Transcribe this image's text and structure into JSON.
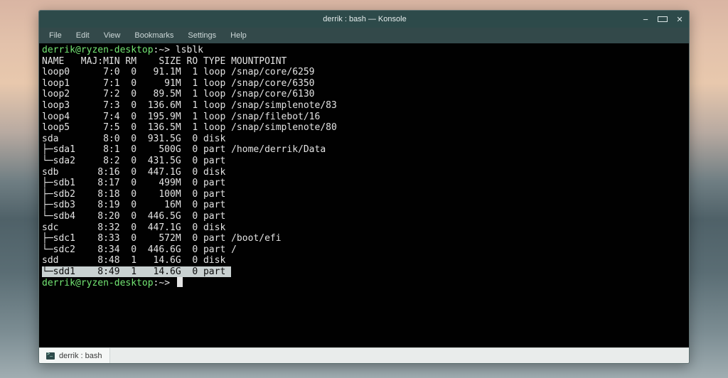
{
  "titlebar": {
    "title": "derrik : bash — Konsole"
  },
  "menubar": {
    "items": [
      "File",
      "Edit",
      "View",
      "Bookmarks",
      "Settings",
      "Help"
    ]
  },
  "prompt": {
    "user_host": "derrik@ryzen-desktop",
    "path_sep": ":~> ",
    "command": "lsblk"
  },
  "lsblk": {
    "header": [
      "NAME",
      "MAJ:MIN",
      "RM",
      "SIZE",
      "RO",
      "TYPE",
      "MOUNTPOINT"
    ],
    "rows": [
      {
        "tree": "",
        "name": "loop0",
        "maj": "7:0",
        "rm": "0",
        "size": "91.1M",
        "ro": "1",
        "type": "loop",
        "mnt": "/snap/core/6259"
      },
      {
        "tree": "",
        "name": "loop1",
        "maj": "7:1",
        "rm": "0",
        "size": "91M",
        "ro": "1",
        "type": "loop",
        "mnt": "/snap/core/6350"
      },
      {
        "tree": "",
        "name": "loop2",
        "maj": "7:2",
        "rm": "0",
        "size": "89.5M",
        "ro": "1",
        "type": "loop",
        "mnt": "/snap/core/6130"
      },
      {
        "tree": "",
        "name": "loop3",
        "maj": "7:3",
        "rm": "0",
        "size": "136.6M",
        "ro": "1",
        "type": "loop",
        "mnt": "/snap/simplenote/83"
      },
      {
        "tree": "",
        "name": "loop4",
        "maj": "7:4",
        "rm": "0",
        "size": "195.9M",
        "ro": "1",
        "type": "loop",
        "mnt": "/snap/filebot/16"
      },
      {
        "tree": "",
        "name": "loop5",
        "maj": "7:5",
        "rm": "0",
        "size": "136.5M",
        "ro": "1",
        "type": "loop",
        "mnt": "/snap/simplenote/80"
      },
      {
        "tree": "",
        "name": "sda",
        "maj": "8:0",
        "rm": "0",
        "size": "931.5G",
        "ro": "0",
        "type": "disk",
        "mnt": ""
      },
      {
        "tree": "├─",
        "name": "sda1",
        "maj": "8:1",
        "rm": "0",
        "size": "500G",
        "ro": "0",
        "type": "part",
        "mnt": "/home/derrik/Data"
      },
      {
        "tree": "└─",
        "name": "sda2",
        "maj": "8:2",
        "rm": "0",
        "size": "431.5G",
        "ro": "0",
        "type": "part",
        "mnt": ""
      },
      {
        "tree": "",
        "name": "sdb",
        "maj": "8:16",
        "rm": "0",
        "size": "447.1G",
        "ro": "0",
        "type": "disk",
        "mnt": ""
      },
      {
        "tree": "├─",
        "name": "sdb1",
        "maj": "8:17",
        "rm": "0",
        "size": "499M",
        "ro": "0",
        "type": "part",
        "mnt": ""
      },
      {
        "tree": "├─",
        "name": "sdb2",
        "maj": "8:18",
        "rm": "0",
        "size": "100M",
        "ro": "0",
        "type": "part",
        "mnt": ""
      },
      {
        "tree": "├─",
        "name": "sdb3",
        "maj": "8:19",
        "rm": "0",
        "size": "16M",
        "ro": "0",
        "type": "part",
        "mnt": ""
      },
      {
        "tree": "└─",
        "name": "sdb4",
        "maj": "8:20",
        "rm": "0",
        "size": "446.5G",
        "ro": "0",
        "type": "part",
        "mnt": ""
      },
      {
        "tree": "",
        "name": "sdc",
        "maj": "8:32",
        "rm": "0",
        "size": "447.1G",
        "ro": "0",
        "type": "disk",
        "mnt": ""
      },
      {
        "tree": "├─",
        "name": "sdc1",
        "maj": "8:33",
        "rm": "0",
        "size": "572M",
        "ro": "0",
        "type": "part",
        "mnt": "/boot/efi"
      },
      {
        "tree": "└─",
        "name": "sdc2",
        "maj": "8:34",
        "rm": "0",
        "size": "446.6G",
        "ro": "0",
        "type": "part",
        "mnt": "/"
      },
      {
        "tree": "",
        "name": "sdd",
        "maj": "8:48",
        "rm": "1",
        "size": "14.6G",
        "ro": "0",
        "type": "disk",
        "mnt": ""
      },
      {
        "tree": "└─",
        "name": "sdd1",
        "maj": "8:49",
        "rm": "1",
        "size": "14.6G",
        "ro": "0",
        "type": "part",
        "mnt": "",
        "selected": true
      }
    ]
  },
  "tab": {
    "label": "derrik : bash"
  }
}
